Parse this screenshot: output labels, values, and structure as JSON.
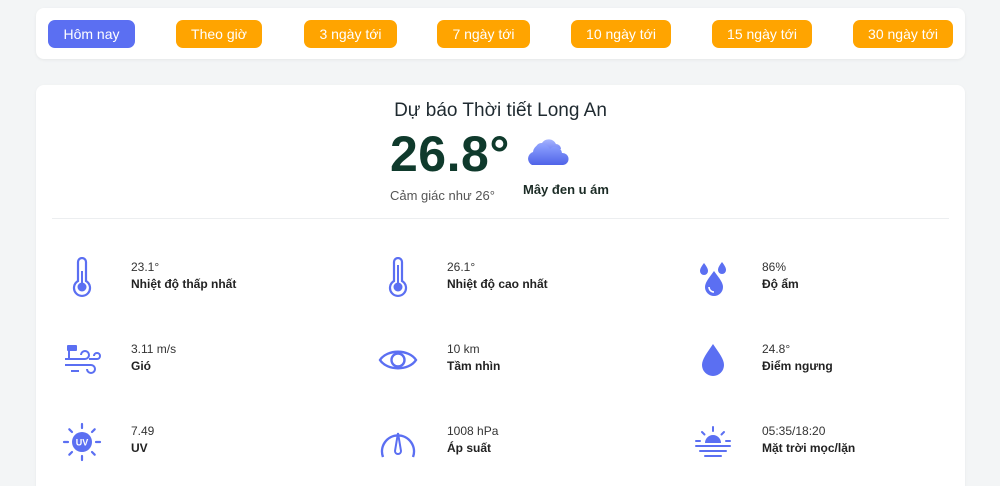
{
  "tabs": [
    {
      "label": "Hôm nay",
      "active": true
    },
    {
      "label": "Theo giờ",
      "active": false
    },
    {
      "label": "3 ngày tới",
      "active": false
    },
    {
      "label": "7 ngày tới",
      "active": false
    },
    {
      "label": "10 ngày tới",
      "active": false
    },
    {
      "label": "15 ngày tới",
      "active": false
    },
    {
      "label": "30 ngày tới",
      "active": false
    }
  ],
  "forecast": {
    "title": "Dự báo Thời tiết Long An",
    "temperature": "26.8°",
    "feels_like": "Cảm giác như 26°",
    "condition": "Mây đen u ám",
    "condition_icon": "cloud-icon"
  },
  "metrics": [
    {
      "value": "23.1°",
      "label": "Nhiệt độ thấp nhất",
      "icon": "thermometer-low-icon"
    },
    {
      "value": "26.1°",
      "label": "Nhiệt độ cao nhất",
      "icon": "thermometer-high-icon"
    },
    {
      "value": "86%",
      "label": "Độ ẩm",
      "icon": "humidity-icon"
    },
    {
      "value": "3.11 m/s",
      "label": "Gió",
      "icon": "wind-icon"
    },
    {
      "value": "10 km",
      "label": "Tầm nhìn",
      "icon": "eye-icon"
    },
    {
      "value": "24.8°",
      "label": "Điểm ngưng",
      "icon": "dewpoint-icon"
    },
    {
      "value": "7.49",
      "label": "UV",
      "icon": "uv-icon"
    },
    {
      "value": "1008 hPa",
      "label": "Áp suất",
      "icon": "pressure-icon"
    },
    {
      "value": "05:35/18:20",
      "label": "Mặt trời mọc/lặn",
      "icon": "sunrise-sunset-icon"
    }
  ],
  "colors": {
    "tab_active": "#5b6ff2",
    "tab_inactive": "#ffa400",
    "icon": "#5b6ff2",
    "temperature_text": "#0f3a2c"
  }
}
